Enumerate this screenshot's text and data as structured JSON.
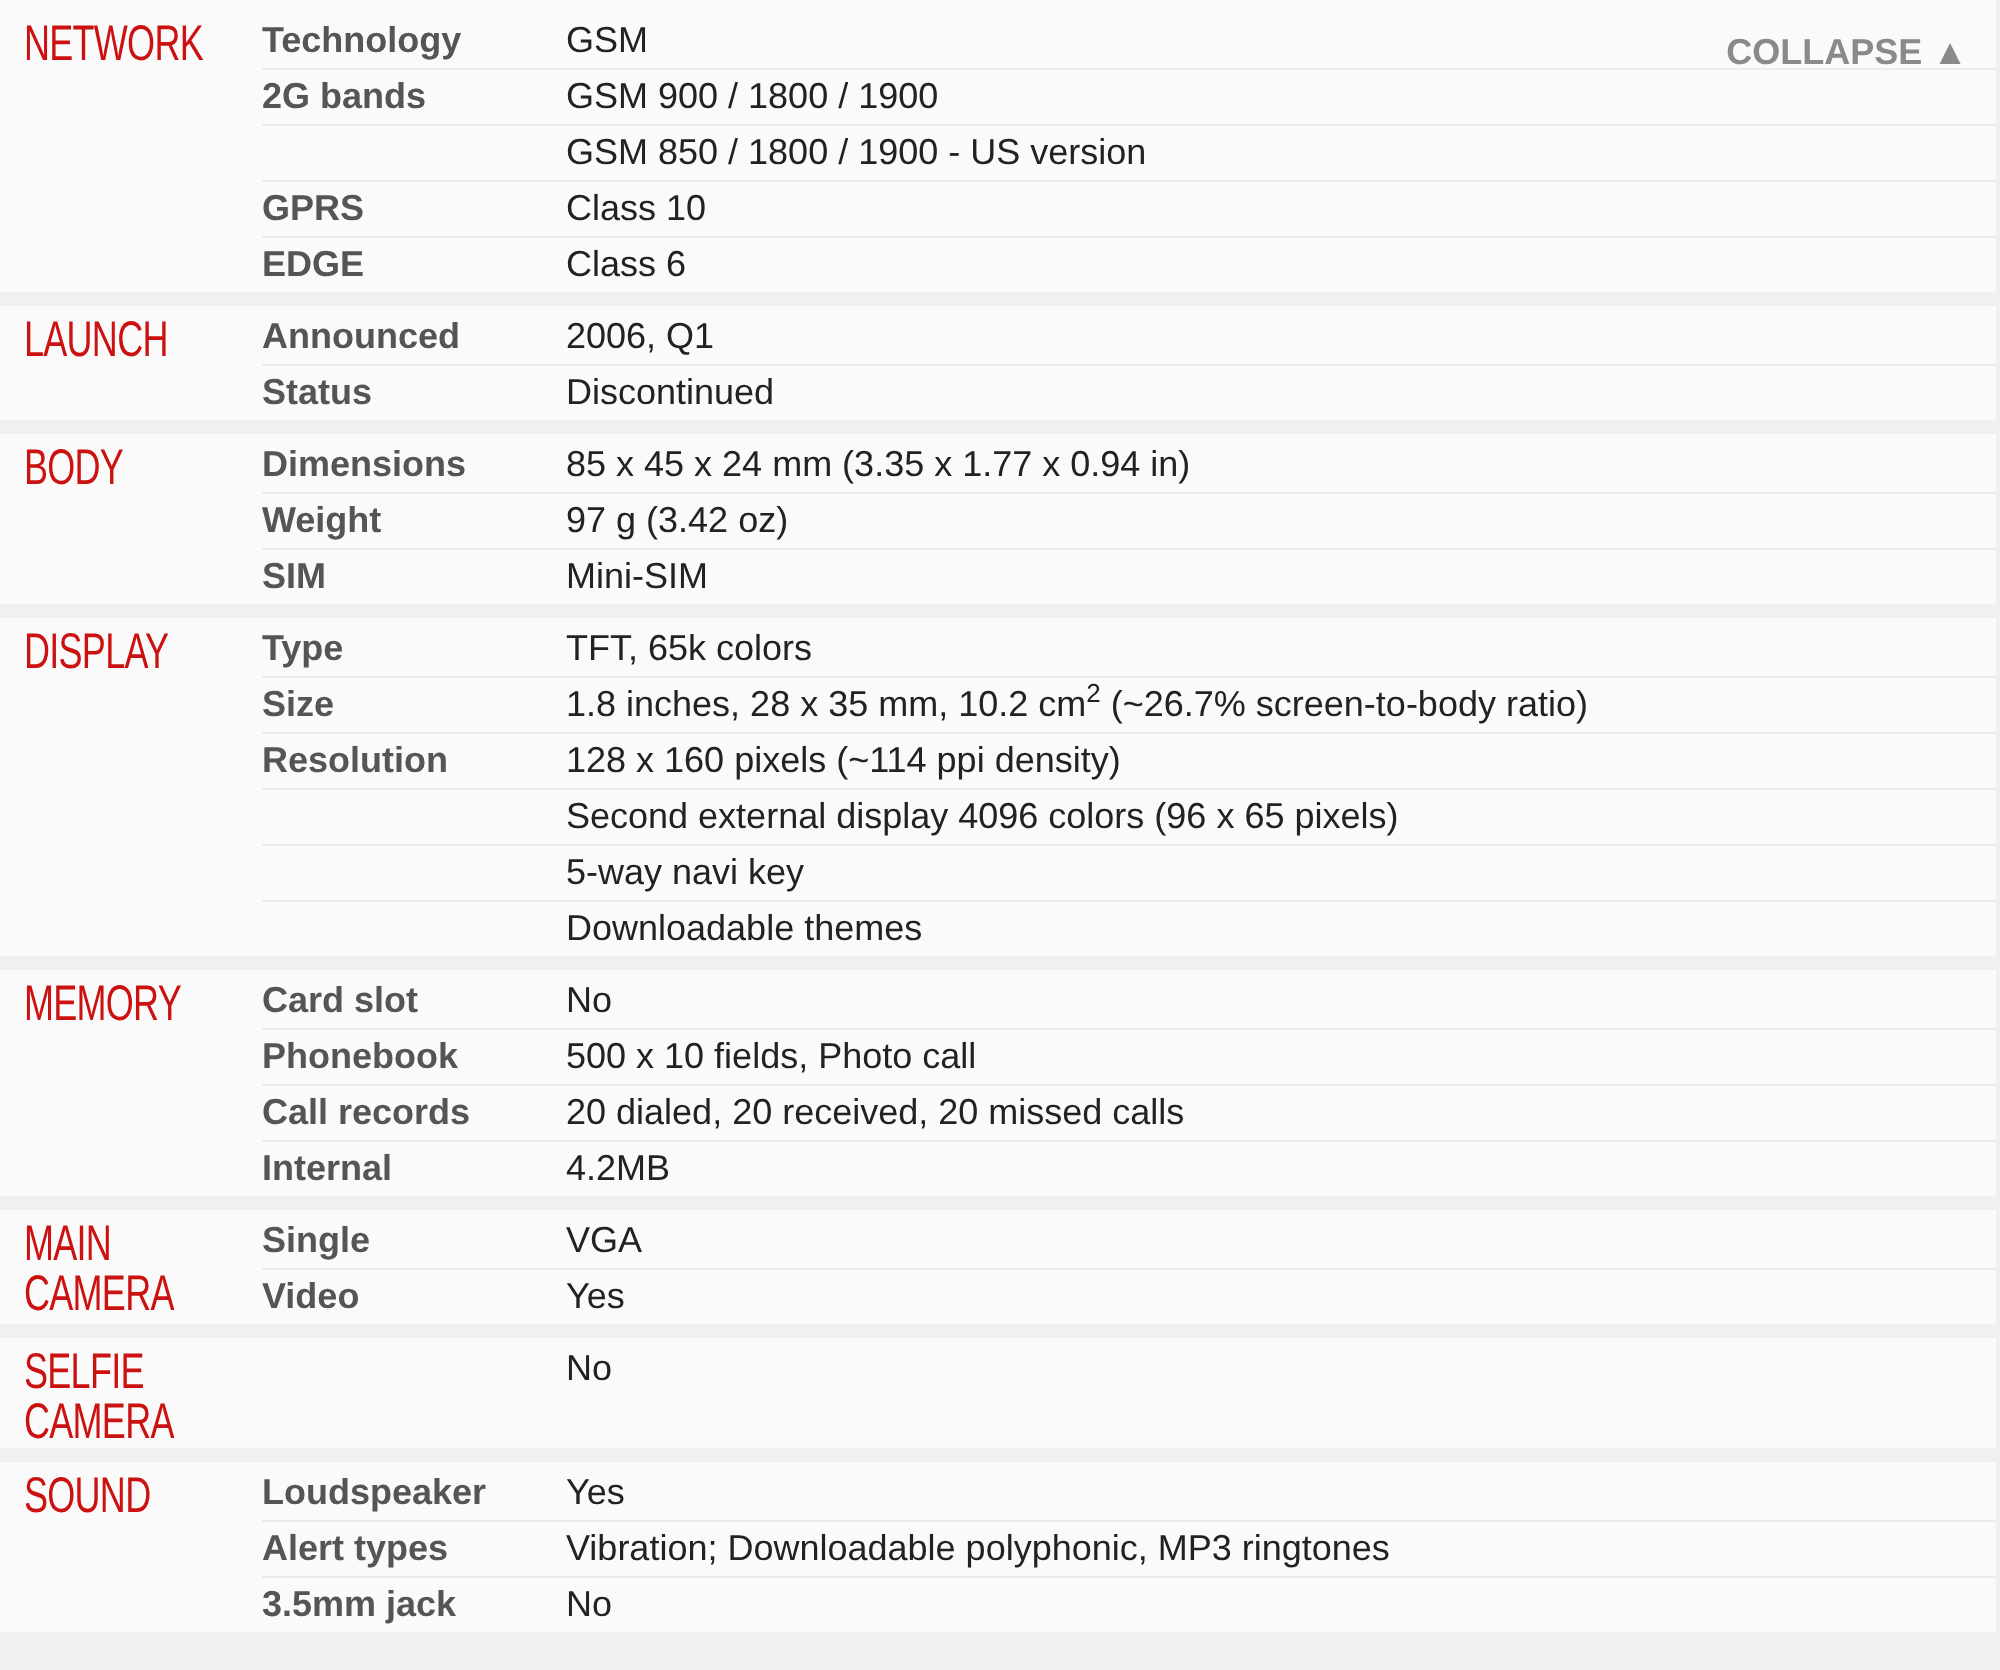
{
  "collapse_button": {
    "label": "COLLAPSE ▲"
  },
  "sections": [
    {
      "title": "NETWORK",
      "rows": [
        {
          "label": "Technology",
          "value": "GSM"
        },
        {
          "label": "2G bands",
          "value": "GSM 900 / 1800 / 1900"
        },
        {
          "value": "GSM 850 / 1800 / 1900 - US version"
        },
        {
          "label": "GPRS",
          "value": "Class 10"
        },
        {
          "label": "EDGE",
          "value": "Class 6"
        }
      ]
    },
    {
      "title": "LAUNCH",
      "rows": [
        {
          "label": "Announced",
          "value": "2006, Q1"
        },
        {
          "label": "Status",
          "value": "Discontinued"
        }
      ]
    },
    {
      "title": "BODY",
      "rows": [
        {
          "label": "Dimensions",
          "value": "85 x 45 x 24 mm (3.35 x 1.77 x 0.94 in)"
        },
        {
          "label": "Weight",
          "value": "97 g (3.42 oz)"
        },
        {
          "label": "SIM",
          "value": "Mini-SIM"
        }
      ]
    },
    {
      "title": "DISPLAY",
      "rows": [
        {
          "label": "Type",
          "value": "TFT, 65k colors"
        },
        {
          "label": "Size",
          "value": "1.8 inches, 28 x 35 mm, 10.2 cm$^{2}$ (~26.7% screen-to-body ratio)"
        },
        {
          "label": "Resolution",
          "value": "128 x 160 pixels (~114 ppi density)"
        },
        {
          "value": "Second external display 4096 colors (96 x 65 pixels)"
        },
        {
          "value": "5-way navi key"
        },
        {
          "value": "Downloadable themes"
        }
      ]
    },
    {
      "title": "MEMORY",
      "rows": [
        {
          "label": "Card slot",
          "value": "No"
        },
        {
          "label": "Phonebook",
          "value": "500 x 10 fields, Photo call"
        },
        {
          "label": "Call records",
          "value": "20 dialed, 20 received, 20 missed calls"
        },
        {
          "label": "Internal",
          "value": "4.2MB"
        }
      ]
    },
    {
      "title": "MAIN CAMERA",
      "rows": [
        {
          "label": "Single",
          "value": "VGA"
        },
        {
          "label": "Video",
          "value": "Yes"
        }
      ]
    },
    {
      "title": "SELFIE CAMERA",
      "rows": [
        {
          "value": "No"
        }
      ]
    },
    {
      "title": "SOUND",
      "rows": [
        {
          "label": "Loudspeaker",
          "value": "Yes"
        },
        {
          "label": "Alert types",
          "value": "Vibration; Downloadable polyphonic, MP3 ringtones"
        },
        {
          "label": "3.5mm jack",
          "value": "No"
        }
      ]
    }
  ]
}
